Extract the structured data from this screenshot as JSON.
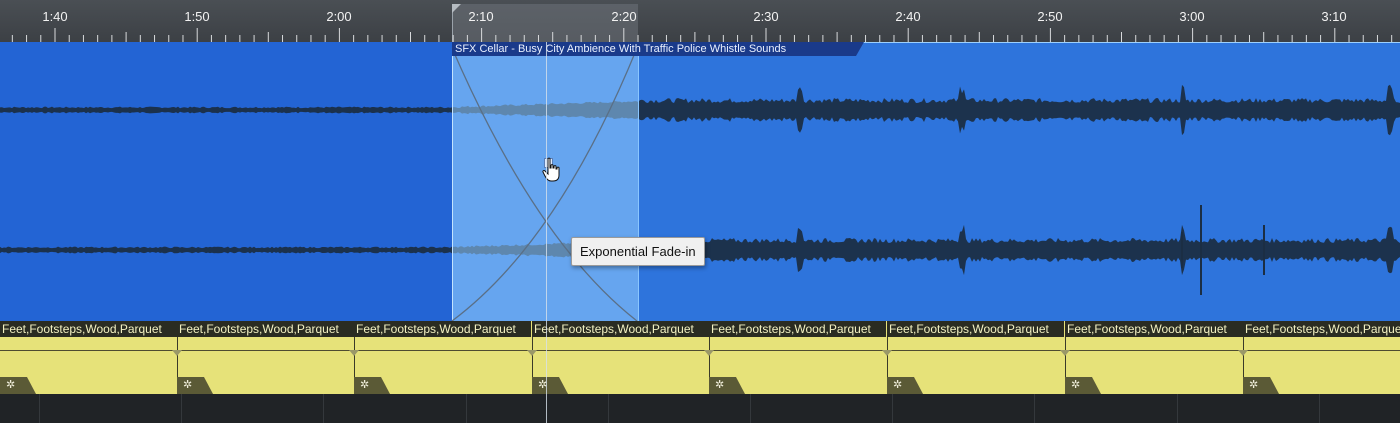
{
  "ruler": {
    "labels": [
      "1:40",
      "1:50",
      "2:00",
      "2:10",
      "2:20",
      "2:30",
      "2:40",
      "2:50",
      "3:00",
      "3:10"
    ]
  },
  "audio_clip": {
    "title": "SFX Cellar - Busy City Ambience With Traffic Police Whistle Sounds"
  },
  "tooltip": {
    "text": "Exponential Fade-in"
  },
  "footsteps_track": {
    "clips": [
      "Feet,Footsteps,Wood,Parquet",
      "Feet,Footsteps,Wood,Parquet",
      "Feet,Footsteps,Wood,Parquet",
      "Feet,Footsteps,Wood,Parquet",
      "Feet,Footsteps,Wood,Parquet",
      "Feet,Footsteps,Wood,Parquet",
      "Feet,Footsteps,Wood,Parquet",
      "Feet,Footsteps,Wood,Parquet"
    ]
  },
  "colors": {
    "audio_clip": "#2e74dc",
    "fade_region": "#8fc9ff",
    "footsteps_clip": "#e6e279",
    "ruler": "#43474c"
  },
  "icons": {
    "cursor": "hand-pointer-icon",
    "clip_gear": "gear-icon"
  }
}
